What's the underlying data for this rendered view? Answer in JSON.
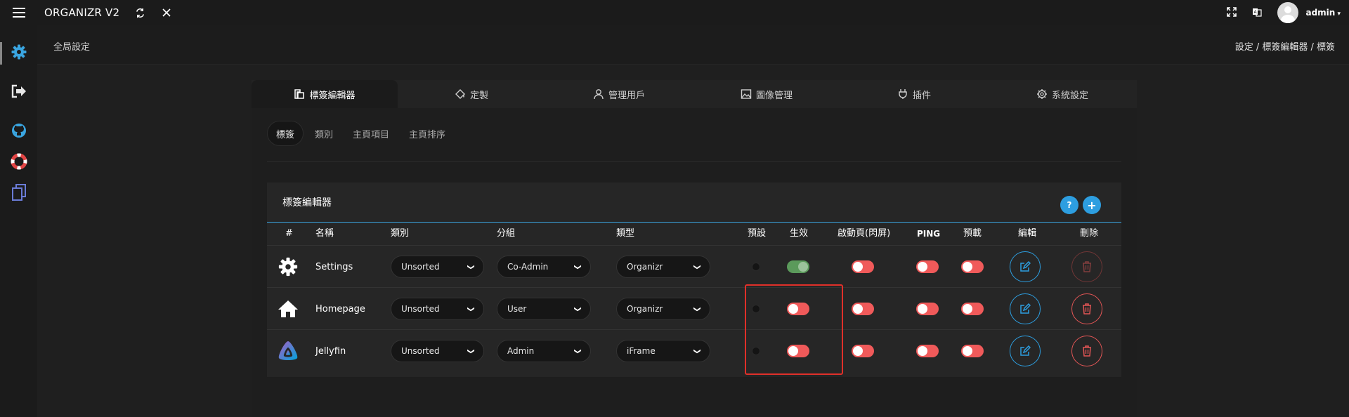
{
  "app": {
    "title": "ORGANIZR V2"
  },
  "topbar": {
    "user": "admin"
  },
  "breadcrumb": {
    "left": "全局設定",
    "right": "設定 / 標簽編輯器 / 標簽"
  },
  "main_tabs": [
    {
      "label": "標簽編輯器",
      "icon": "tag-editor-icon"
    },
    {
      "label": "定製",
      "icon": "paint-bucket-icon"
    },
    {
      "label": "管理用戶",
      "icon": "user-icon"
    },
    {
      "label": "圖像管理",
      "icon": "image-icon"
    },
    {
      "label": "插件",
      "icon": "plug-icon"
    },
    {
      "label": "系統設定",
      "icon": "gear-icon"
    }
  ],
  "sub_tabs": [
    "標簽",
    "類別",
    "主頁項目",
    "主頁排序"
  ],
  "table": {
    "title": "標簽編輯器",
    "help_label": "?",
    "add_label": "+",
    "headers": {
      "num": "#",
      "name": "名稱",
      "category": "類別",
      "group": "分組",
      "type": "類型",
      "default": "預設",
      "enabled": "生效",
      "splash": "啟動頁(閃屏)",
      "ping": "PING",
      "preload": "預載",
      "edit": "編輯",
      "delete": "刪除"
    },
    "rows": [
      {
        "name": "Settings",
        "icon": "gear-icon",
        "category": "Unsorted",
        "group": "Co-Admin",
        "type": "Organizr",
        "enabled": true,
        "splash": false,
        "ping": false,
        "preload": false
      },
      {
        "name": "Homepage",
        "icon": "home-icon",
        "category": "Unsorted",
        "group": "User",
        "type": "Organizr",
        "enabled": false,
        "splash": false,
        "ping": false,
        "preload": false
      },
      {
        "name": "Jellyfin",
        "icon": "jellyfin-icon",
        "category": "Unsorted",
        "group": "Admin",
        "type": "iFrame",
        "enabled": false,
        "splash": false,
        "ping": false,
        "preload": false
      }
    ]
  },
  "colors": {
    "accent": "#2d9ee0",
    "danger": "#e25555",
    "toggle_off": "#f05a5a",
    "toggle_on": "#5b9a5b",
    "highlight": "#e0302a"
  }
}
